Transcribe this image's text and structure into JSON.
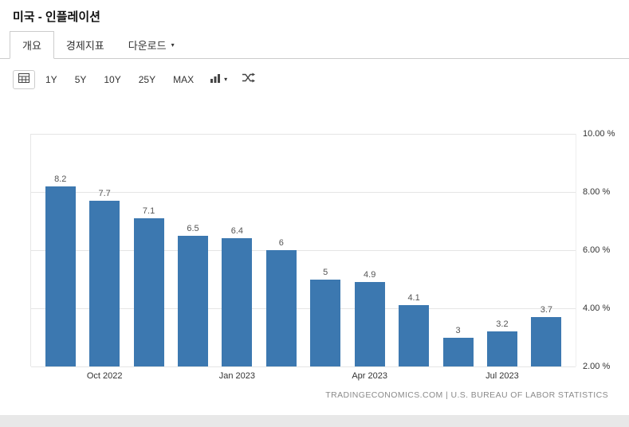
{
  "window": {
    "title": "미국 - 인플레이션"
  },
  "tabs": {
    "items": [
      {
        "label": "개요",
        "active": true
      },
      {
        "label": "경제지표",
        "active": false
      },
      {
        "label": "다운로드",
        "active": false,
        "has_dropdown": true
      }
    ]
  },
  "toolbar": {
    "ranges": [
      "1Y",
      "5Y",
      "10Y",
      "25Y",
      "MAX"
    ]
  },
  "icons": {
    "caret_down": "▾"
  },
  "chart_data": {
    "type": "bar",
    "title": "미국 - 인플레이션",
    "values": [
      8.2,
      7.7,
      7.1,
      6.5,
      6.4,
      6,
      5,
      4.9,
      4.1,
      3,
      3.2,
      3.7
    ],
    "data_labels": [
      "8.2",
      "7.7",
      "7.1",
      "6.5",
      "6.4",
      "6",
      "5",
      "4.9",
      "4.1",
      "3",
      "3.2",
      "3.7"
    ],
    "x_ticks": [
      {
        "index": 1,
        "label": "Oct 2022"
      },
      {
        "index": 4,
        "label": "Jan 2023"
      },
      {
        "index": 7,
        "label": "Apr 2023"
      },
      {
        "index": 10,
        "label": "Jul 2023"
      }
    ],
    "y_ticks": [
      "10.00 %",
      "8.00 %",
      "6.00 %",
      "4.00 %",
      "2.00 %"
    ],
    "ylim": [
      2,
      10
    ],
    "unit": "%",
    "grid": true,
    "legend": "none",
    "bar_color": "#3c78b0",
    "value_label_color": "#555555"
  },
  "footer": {
    "attribution": "TRADINGECONOMICS.COM | U.S. BUREAU OF LABOR STATISTICS"
  }
}
